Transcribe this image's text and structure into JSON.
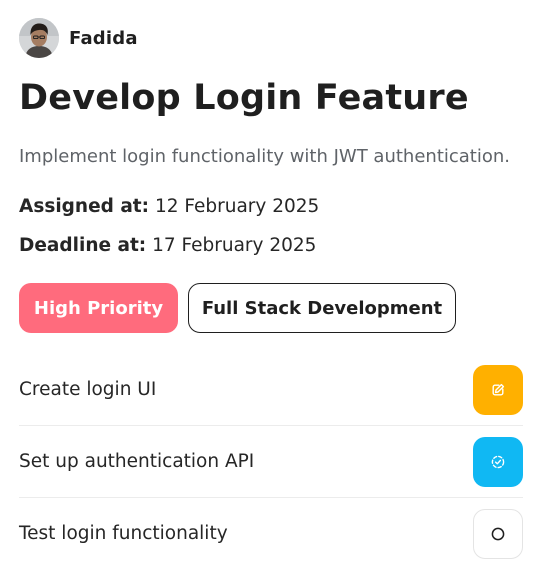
{
  "assignee": {
    "name": "Fadida",
    "avatar_icon": "avatar-photo"
  },
  "task": {
    "title": "Develop Login Feature",
    "description": "Implement login functionality with JWT authentication.",
    "assigned_label": "Assigned at:",
    "assigned_date": "12 February 2025",
    "deadline_label": "Deadline at:",
    "deadline_date": "17 February 2025"
  },
  "tags": {
    "priority": "High Priority",
    "category": "Full Stack Development"
  },
  "subtasks": [
    {
      "label": "Create login UI",
      "status": "in-progress",
      "icon": "pencil-icon",
      "color": "#ffb000"
    },
    {
      "label": "Set up authentication API",
      "status": "in-review",
      "icon": "dashed-check-icon",
      "color": "#10b8f3"
    },
    {
      "label": "Test login functionality",
      "status": "todo",
      "icon": "circle-icon",
      "color": "#ffffff"
    }
  ],
  "colors": {
    "priority": "#ff6b7d",
    "in_progress": "#ffb000",
    "in_review": "#10b8f3",
    "text": "#1f1f1f",
    "muted": "#5f6368"
  }
}
